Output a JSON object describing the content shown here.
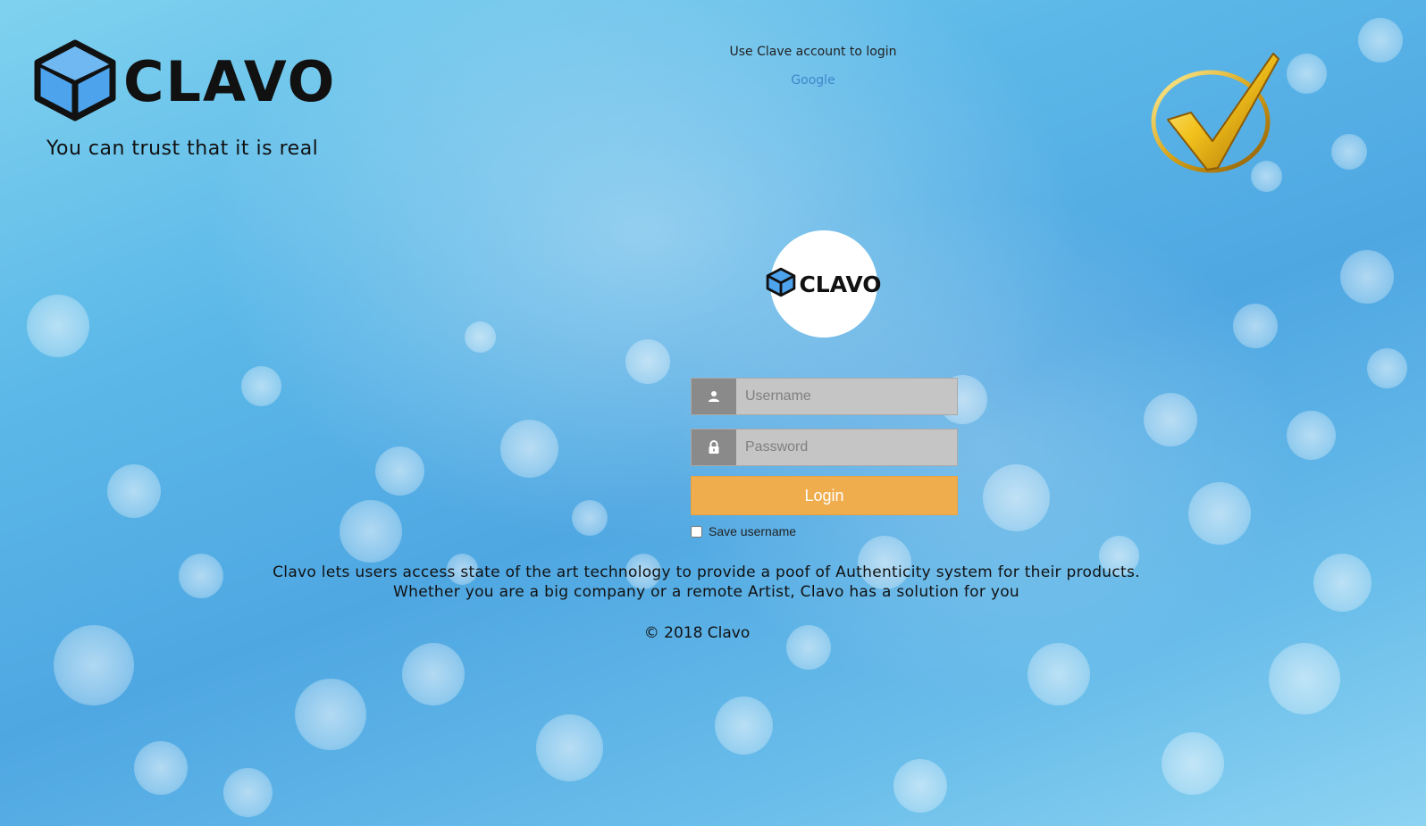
{
  "brand": {
    "name": "CLAVO",
    "tagline": "You can trust that it is real",
    "logo_icon": "cube-icon",
    "badge_icon": "gold-checkmark-icon"
  },
  "external_login": {
    "hint": "Use Clave account to login",
    "provider": "Google"
  },
  "form": {
    "username_placeholder": "Username",
    "username_value": "",
    "password_placeholder": "Password",
    "password_value": "",
    "username_icon": "user-icon",
    "password_icon": "lock-icon",
    "login_label": "Login",
    "remember_label": "Save username",
    "remember_checked": false
  },
  "description": {
    "line1": "Clavo lets users access state of the art technology to provide a poof of Authenticity system for their products.",
    "line2": "Whether you are a big company or a remote Artist, Clavo has a solution for you"
  },
  "footer": {
    "copyright": "© 2018 Clavo"
  },
  "colors": {
    "accent_button": "#f0ad4e",
    "link": "#3f86c9",
    "cube": "#4da3ec",
    "icon_box": "#8a8a8a",
    "input_bg": "#c5c5c5"
  }
}
